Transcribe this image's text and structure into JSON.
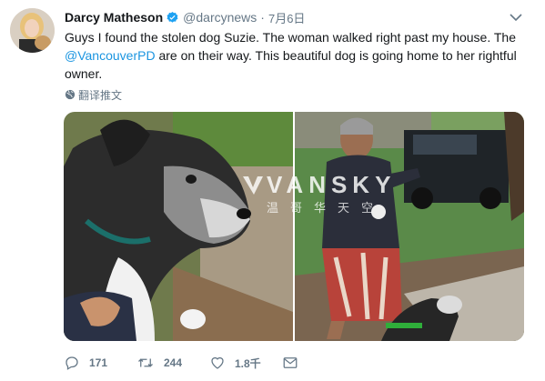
{
  "tweet": {
    "author_name": "Darcy Matheson",
    "handle": "@darcynews",
    "separator": "·",
    "date": "7月6日",
    "verified": true,
    "text_part1": "Guys I found the stolen dog Suzie. The woman walked right past my house. The ",
    "mention": "@VancouverPD",
    "text_part2": " are on their way. This beautiful dog is going home to her rightful owner.",
    "translate_label": "翻译推文"
  },
  "watermark": {
    "main": "VANSKY",
    "sub": "温哥华天空"
  },
  "actions": {
    "replies": "171",
    "retweets": "244",
    "likes": "1.8千",
    "dm": ""
  },
  "colors": {
    "link": "#1b95e0",
    "secondary_text": "#657786",
    "verified_badge": "#1da1f2"
  },
  "icons": {
    "verified": "verified-badge-icon",
    "caret": "chevron-down-icon",
    "globe": "globe-icon",
    "reply": "reply-icon",
    "retweet": "retweet-icon",
    "like": "heart-icon",
    "dm": "envelope-icon"
  }
}
